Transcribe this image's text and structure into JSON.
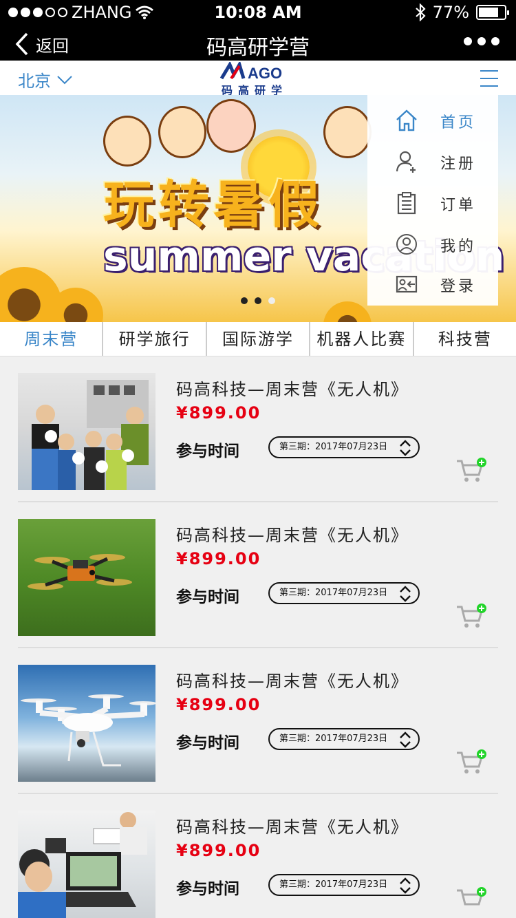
{
  "status_bar": {
    "carrier": "ZHANG",
    "time": "10:08 AM",
    "battery_percent": "77%",
    "battery_level": 0.77
  },
  "nav": {
    "back_label": "返回",
    "title": "码高研学营"
  },
  "header": {
    "city": "北京",
    "logo_mark": "AGO",
    "logo_subtitle": "码高研学"
  },
  "banner": {
    "headline": "玩转暑假",
    "subline": "summer vacation",
    "pages": 3,
    "current_page": 2
  },
  "menu": {
    "items": [
      {
        "label": "首页",
        "icon": "home-icon",
        "active": true
      },
      {
        "label": "注册",
        "icon": "user-add-icon",
        "active": false
      },
      {
        "label": "订单",
        "icon": "clipboard-icon",
        "active": false
      },
      {
        "label": "我的",
        "icon": "profile-icon",
        "active": false
      },
      {
        "label": "登录",
        "icon": "login-icon",
        "active": false
      }
    ]
  },
  "tabs": [
    {
      "label": "周末营",
      "active": true
    },
    {
      "label": "研学旅行",
      "active": false
    },
    {
      "label": "国际游学",
      "active": false
    },
    {
      "label": "机器人比赛",
      "active": false
    },
    {
      "label": "科技营",
      "active": false
    }
  ],
  "products": [
    {
      "title": "码高科技—周末营《无人机》",
      "price": "¥899.00",
      "time_label": "参与时间",
      "session": "第三期：2017年07月23日"
    },
    {
      "title": "码高科技—周末营《无人机》",
      "price": "¥899.00",
      "time_label": "参与时间",
      "session": "第三期：2017年07月23日"
    },
    {
      "title": "码高科技—周末营《无人机》",
      "price": "¥899.00",
      "time_label": "参与时间",
      "session": "第三期：2017年07月23日"
    },
    {
      "title": "码高科技—周末营《无人机》",
      "price": "¥899.00",
      "time_label": "参与时间",
      "session": "第三期：2017年07月23日"
    }
  ],
  "colors": {
    "accent": "#3a86c8",
    "price": "#e60012",
    "cart_badge": "#22d42a"
  }
}
